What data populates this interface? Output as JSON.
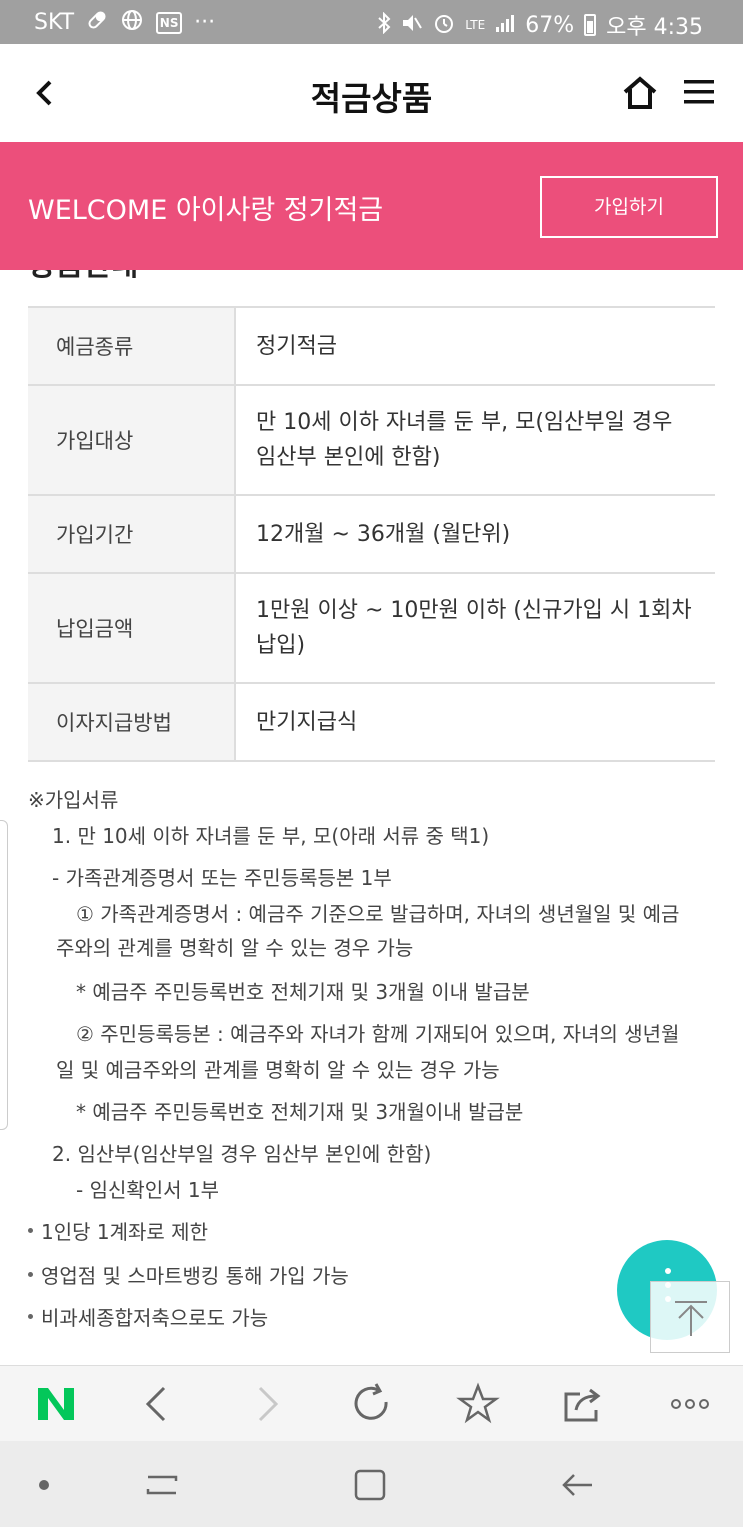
{
  "status_bar": {
    "carrier": "SKT",
    "ns_badge": "NS",
    "more": "···",
    "network": "LTE",
    "battery": "67%",
    "time": "오후 4:35"
  },
  "header": {
    "title": "적금상품"
  },
  "banner": {
    "product_name": "WELCOME 아이사랑 정기적금",
    "join_label": "가입하기",
    "color": "#ec4f7b"
  },
  "section": {
    "heading": "상품안내"
  },
  "table": {
    "rows": [
      {
        "label": "예금종류",
        "value": "정기적금"
      },
      {
        "label": "가입대상",
        "value": "만 10세 이하 자녀를 둔 부, 모(임산부일 경우 임산부 본인에 한함)"
      },
      {
        "label": "가입기간",
        "value": "12개월 ~ 36개월 (월단위)"
      },
      {
        "label": "납입금액",
        "value": "1만원 이상 ~ 10만원 이하 (신규가입 시 1회차 납입)"
      },
      {
        "label": "이자지급방법",
        "value": "만기지급식"
      }
    ]
  },
  "notes": {
    "heading": "※가입서류",
    "item1": "1. 만 10세 이하 자녀를 둔 부, 모(아래 서류 중 택1)",
    "item1_sub": "- 가족관계증명서 또는 주민등록등본 1부",
    "doc1_a": "① 가족관계증명서 : 예금주 기준으로 발급하며, 자녀의 생년월일 및 예금",
    "doc1_b": "주와의 관계를 명확히 알 수 있는 경우 가능",
    "doc1_note": "* 예금주 주민등록번호 전체기재 및 3개월 이내 발급분",
    "doc2_a": "② 주민등록등본 : 예금주와 자녀가 함께 기재되어 있으며, 자녀의 생년월",
    "doc2_b": "일 및 예금주와의 관계를 명확히 알 수 있는 경우 가능",
    "doc2_note": "* 예금주 주민등록번호 전체기재 및 3개월이내 발급분",
    "item2": "2. 임산부(임산부일 경우 임산부 본인에 한함)",
    "item2_sub": "- 임신확인서 1부"
  },
  "bullets": [
    "1인당 1계좌로 제한",
    "영업점 및 스마트뱅킹 통해 가입 가능",
    "비과세종합저축으로도 가능"
  ],
  "fab": {
    "color": "#1fc9c3"
  },
  "browser": {
    "icons": [
      "naver-icon",
      "back-icon",
      "forward-icon",
      "refresh-icon",
      "bookmark-icon",
      "share-icon",
      "more-icon"
    ]
  }
}
